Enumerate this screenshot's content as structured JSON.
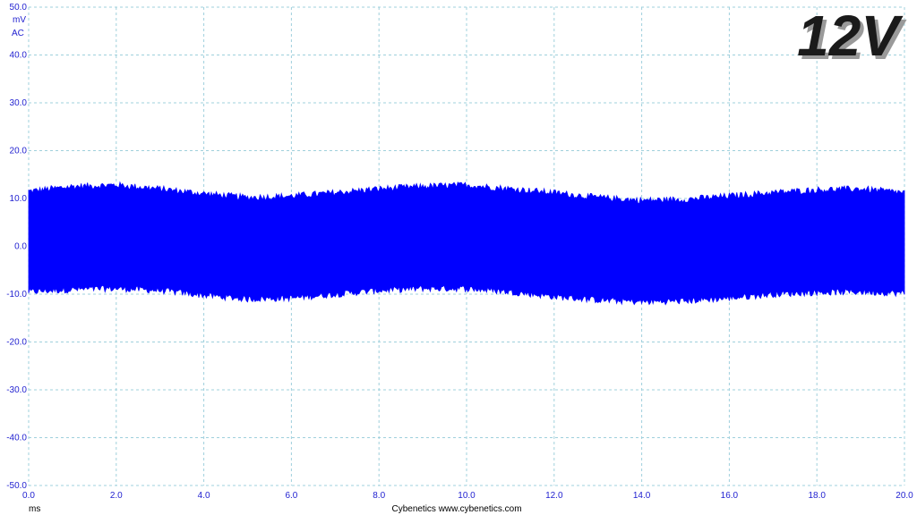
{
  "chart_data": {
    "type": "line",
    "title": "",
    "badge": "12V",
    "ylabel_unit": "mV",
    "ylabel_mode": "AC",
    "xlabel": "ms",
    "credit": "Cybenetics   www.cybenetics.com",
    "xlim": [
      0,
      20
    ],
    "ylim": [
      -50,
      50
    ],
    "x_ticks": [
      "0.0",
      "2.0",
      "4.0",
      "6.0",
      "8.0",
      "10.0",
      "12.0",
      "14.0",
      "16.0",
      "18.0",
      "20.0"
    ],
    "y_ticks": [
      "50.0",
      "40.0",
      "30.0",
      "20.0",
      "10.0",
      "0.0",
      "-10.0",
      "-20.0",
      "-30.0",
      "-40.0",
      "-50.0"
    ],
    "grid": true,
    "series": [
      {
        "color": "#0000ff",
        "envelope_x": [
          0,
          1,
          2,
          3,
          4,
          5,
          6,
          7,
          8,
          9,
          10,
          11,
          12,
          13,
          14,
          15,
          16,
          17,
          18,
          19,
          20
        ],
        "envelope_upper": [
          11.5,
          12.5,
          12.8,
          12.0,
          11.0,
          10.2,
          10.5,
          11.2,
          12.0,
          12.5,
          12.8,
          12.0,
          11.2,
          10.2,
          9.6,
          9.8,
          10.5,
          11.2,
          11.8,
          12.0,
          11.2
        ],
        "envelope_lower": [
          -9.5,
          -9.0,
          -8.8,
          -9.2,
          -10.2,
          -11.0,
          -10.8,
          -10.0,
          -9.2,
          -8.8,
          -8.8,
          -9.5,
          -10.5,
          -11.2,
          -11.6,
          -11.4,
          -10.8,
          -10.0,
          -9.6,
          -9.5,
          -9.8
        ]
      }
    ]
  }
}
